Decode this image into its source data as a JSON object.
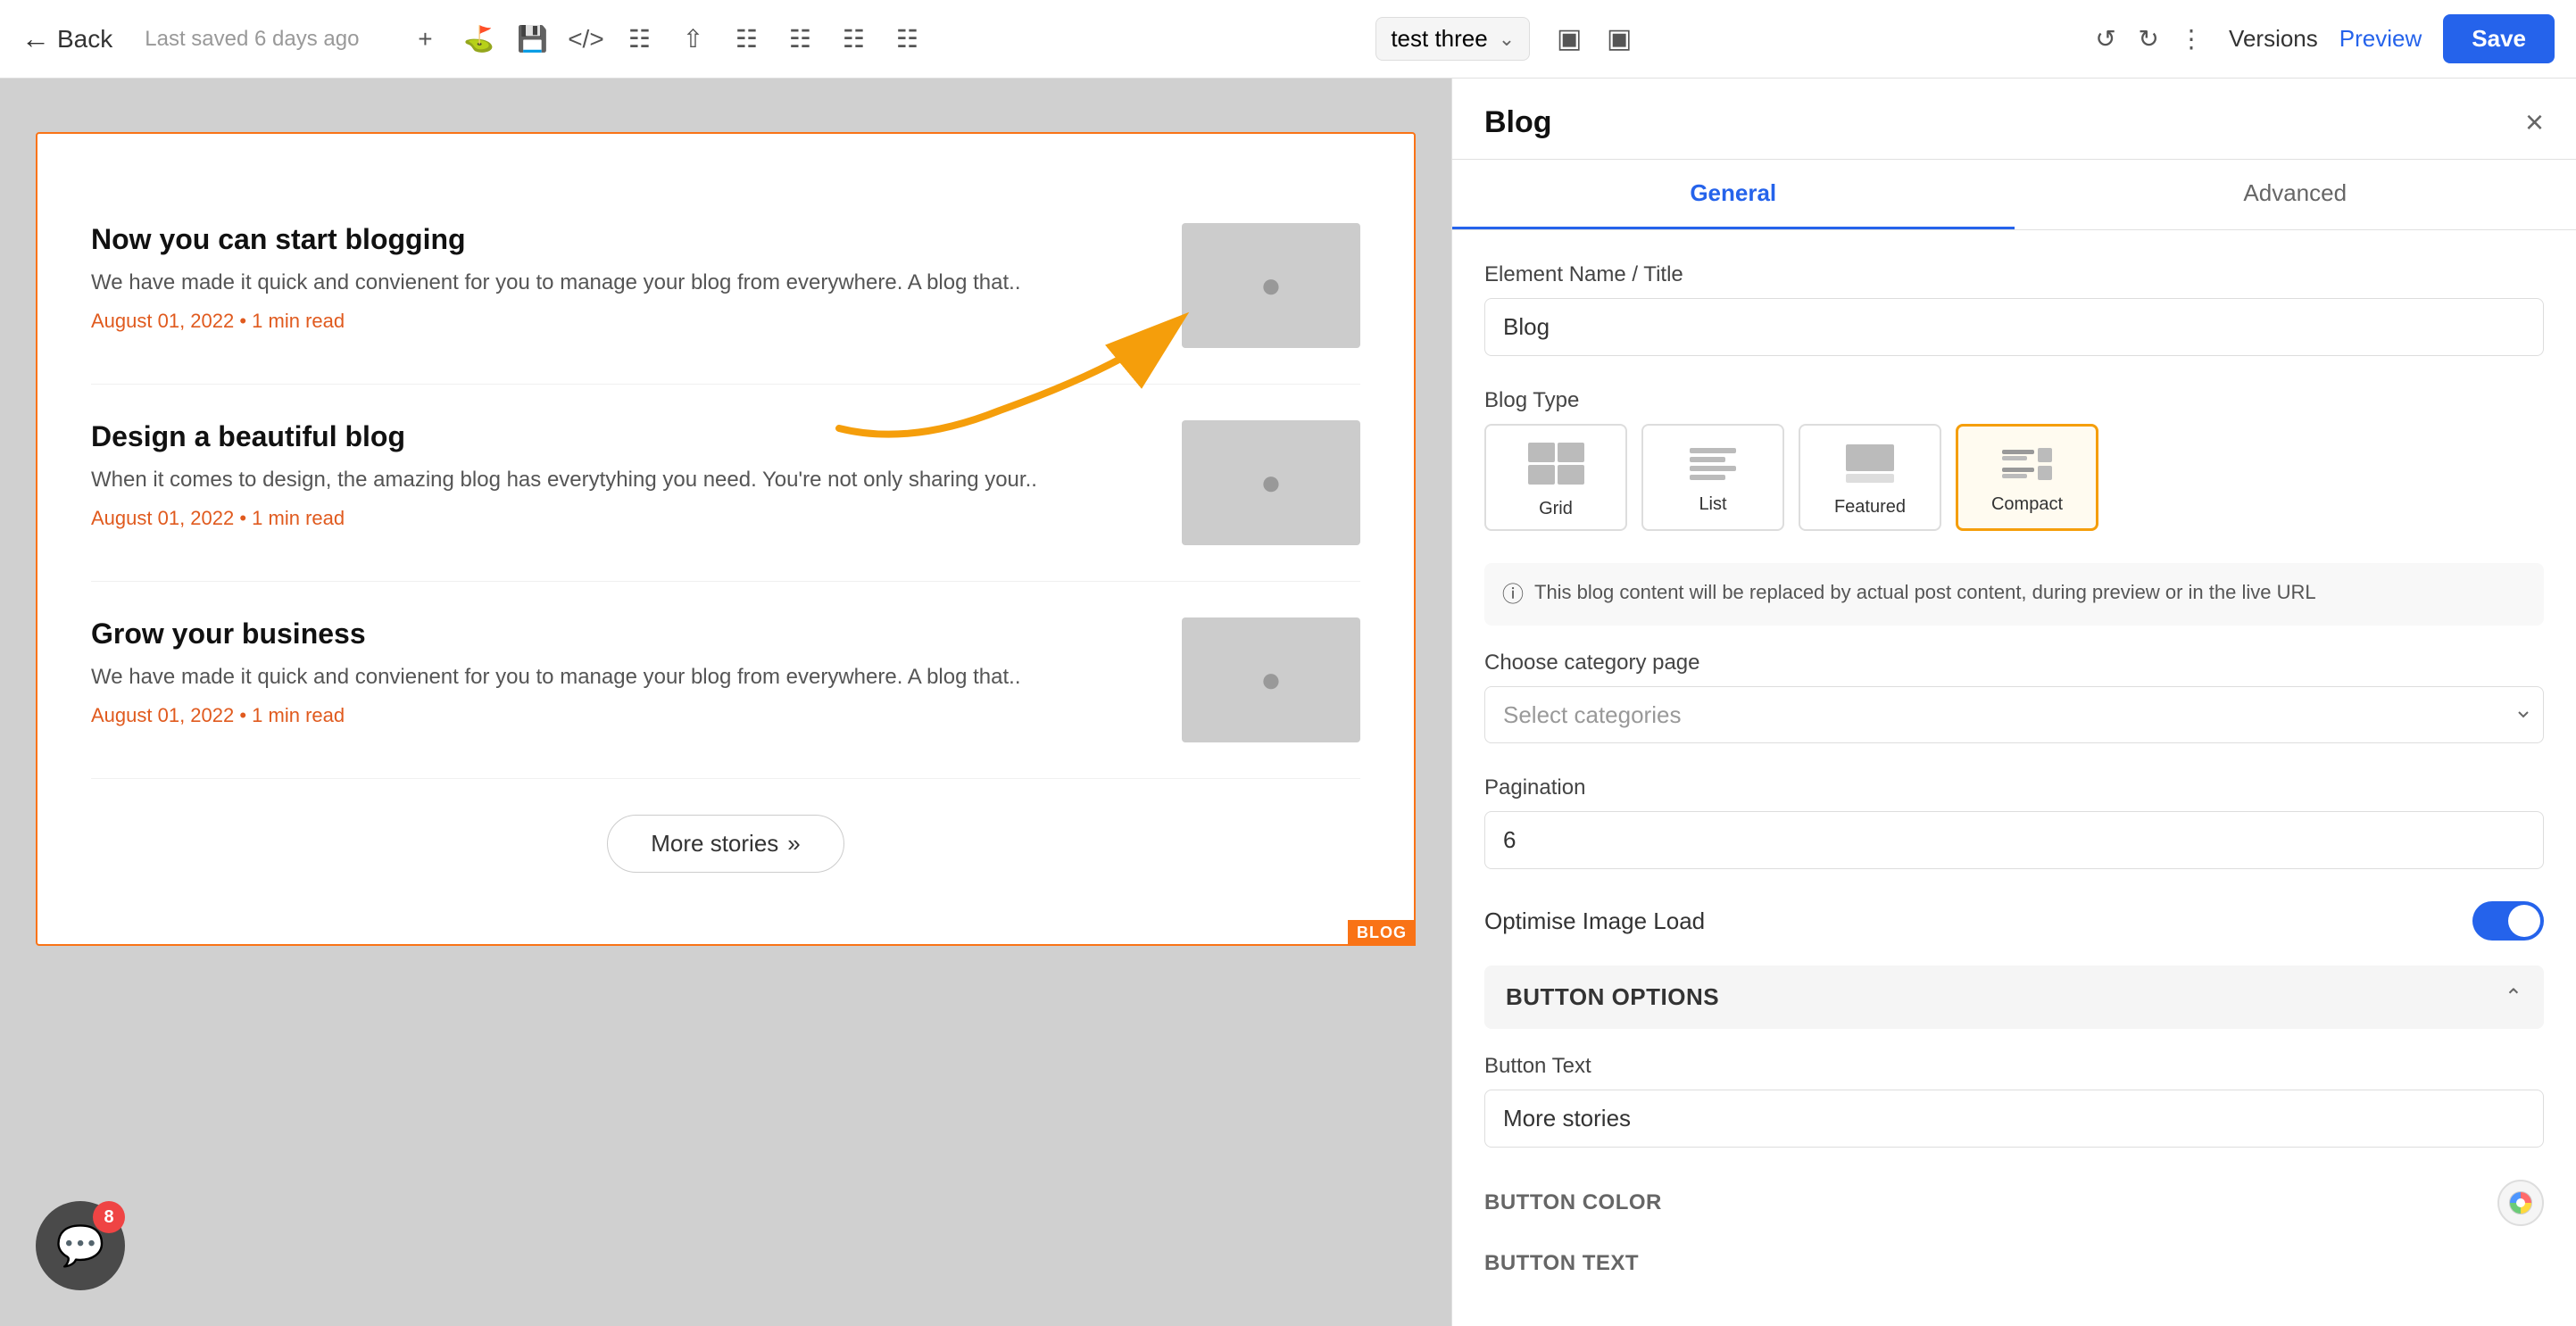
{
  "toolbar": {
    "back_label": "Back",
    "saved_text": "Last saved 6 days ago",
    "versions_label": "Versions",
    "preview_label": "Preview",
    "save_label": "Save",
    "page_name": "test three"
  },
  "panel": {
    "title": "Blog",
    "close_icon": "×",
    "tabs": [
      {
        "label": "General",
        "active": true
      },
      {
        "label": "Advanced",
        "active": false
      }
    ],
    "element_name_label": "Element Name / Title",
    "element_name_value": "Blog",
    "blog_type_label": "Blog Type",
    "blog_types": [
      {
        "label": "Grid",
        "id": "grid"
      },
      {
        "label": "List",
        "id": "list"
      },
      {
        "label": "Featured",
        "id": "featured"
      },
      {
        "label": "Compact",
        "id": "compact",
        "selected": true
      }
    ],
    "info_text": "This blog content will be replaced by actual post content, during preview or in the live URL",
    "choose_category_label": "Choose category page",
    "category_placeholder": "Select categories",
    "pagination_label": "Pagination",
    "pagination_value": "6",
    "optimise_image_label": "Optimise Image Load",
    "button_options_label": "Button Options",
    "button_text_label": "Button Text",
    "button_text_value": "More stories",
    "button_color_label": "BUTTON COLOR",
    "button_text_color_label": "BUTTON TEXT"
  },
  "blog": {
    "posts": [
      {
        "title": "Now you can start blogging",
        "description": "We have made it quick and convienent for you to manage your blog from everywhere. A blog that..",
        "meta": "August 01, 2022 • 1 min read"
      },
      {
        "title": "Design a beautiful blog",
        "description": "When it comes to design, the amazing blog has everytyhing you need. You're not only sharing your..",
        "meta": "August 01, 2022 • 1 min read"
      },
      {
        "title": "Grow your business",
        "description": "We have made it quick and convienent for you to manage your blog from everywhere. A blog that..",
        "meta": "August 01, 2022 • 1 min read"
      }
    ],
    "more_stories_label": "More stories",
    "blog_tag": "BLOG"
  },
  "chat": {
    "badge_count": "8"
  }
}
